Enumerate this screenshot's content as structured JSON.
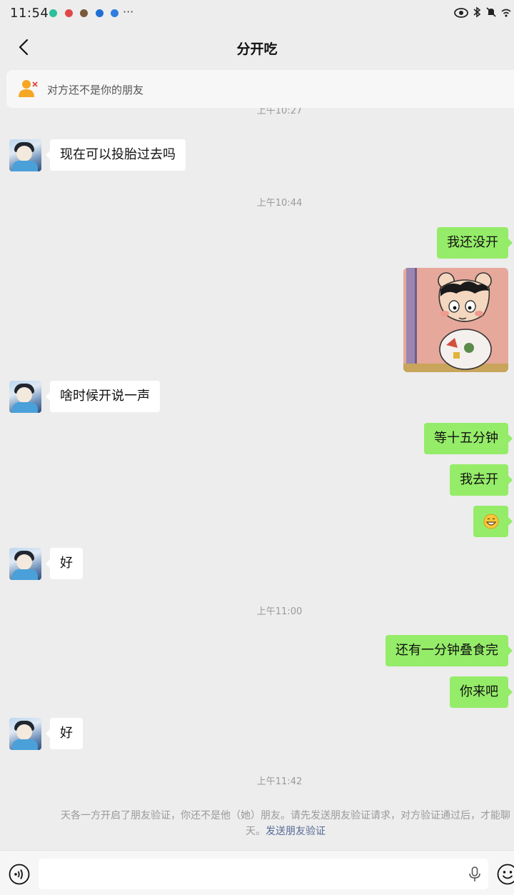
{
  "status_bar": {
    "time": "11:54",
    "more": "···"
  },
  "nav": {
    "title": "分开吃"
  },
  "banner": {
    "text": "对方还不是你的朋友"
  },
  "timestamps": {
    "t1": "上午10:27",
    "t2": "上午10:44",
    "t3": "上午11:00",
    "t4": "上午11:42"
  },
  "messages": [
    {
      "side": "in",
      "text": "现在可以投胎过去吗"
    },
    {
      "side": "out",
      "text": "我还没开"
    },
    {
      "side": "out",
      "type": "sticker"
    },
    {
      "side": "in",
      "text": "啥时候开说一声"
    },
    {
      "side": "out",
      "text": "等十五分钟"
    },
    {
      "side": "out",
      "text": "我去开"
    },
    {
      "side": "out",
      "type": "emoji",
      "icon": "grin-emoji-icon"
    },
    {
      "side": "in",
      "text": "好"
    },
    {
      "side": "out",
      "text": "还有一分钟叠食完"
    },
    {
      "side": "out",
      "text": "你来吧"
    },
    {
      "side": "in",
      "text": "好"
    }
  ],
  "system_notice": {
    "line1": "天各一方开启了朋友验证，你还不是他（她）朋友。请先发送朋友验证请求，对方验证通过后，才能聊",
    "line2_prefix": "天。",
    "link": "发送朋友验证"
  },
  "input": {
    "placeholder": ""
  },
  "colors": {
    "background": "#ededed",
    "outgoing_bubble": "#95ec69",
    "incoming_bubble": "#ffffff",
    "link": "#576b95",
    "banner_icon": "#f5a623"
  }
}
